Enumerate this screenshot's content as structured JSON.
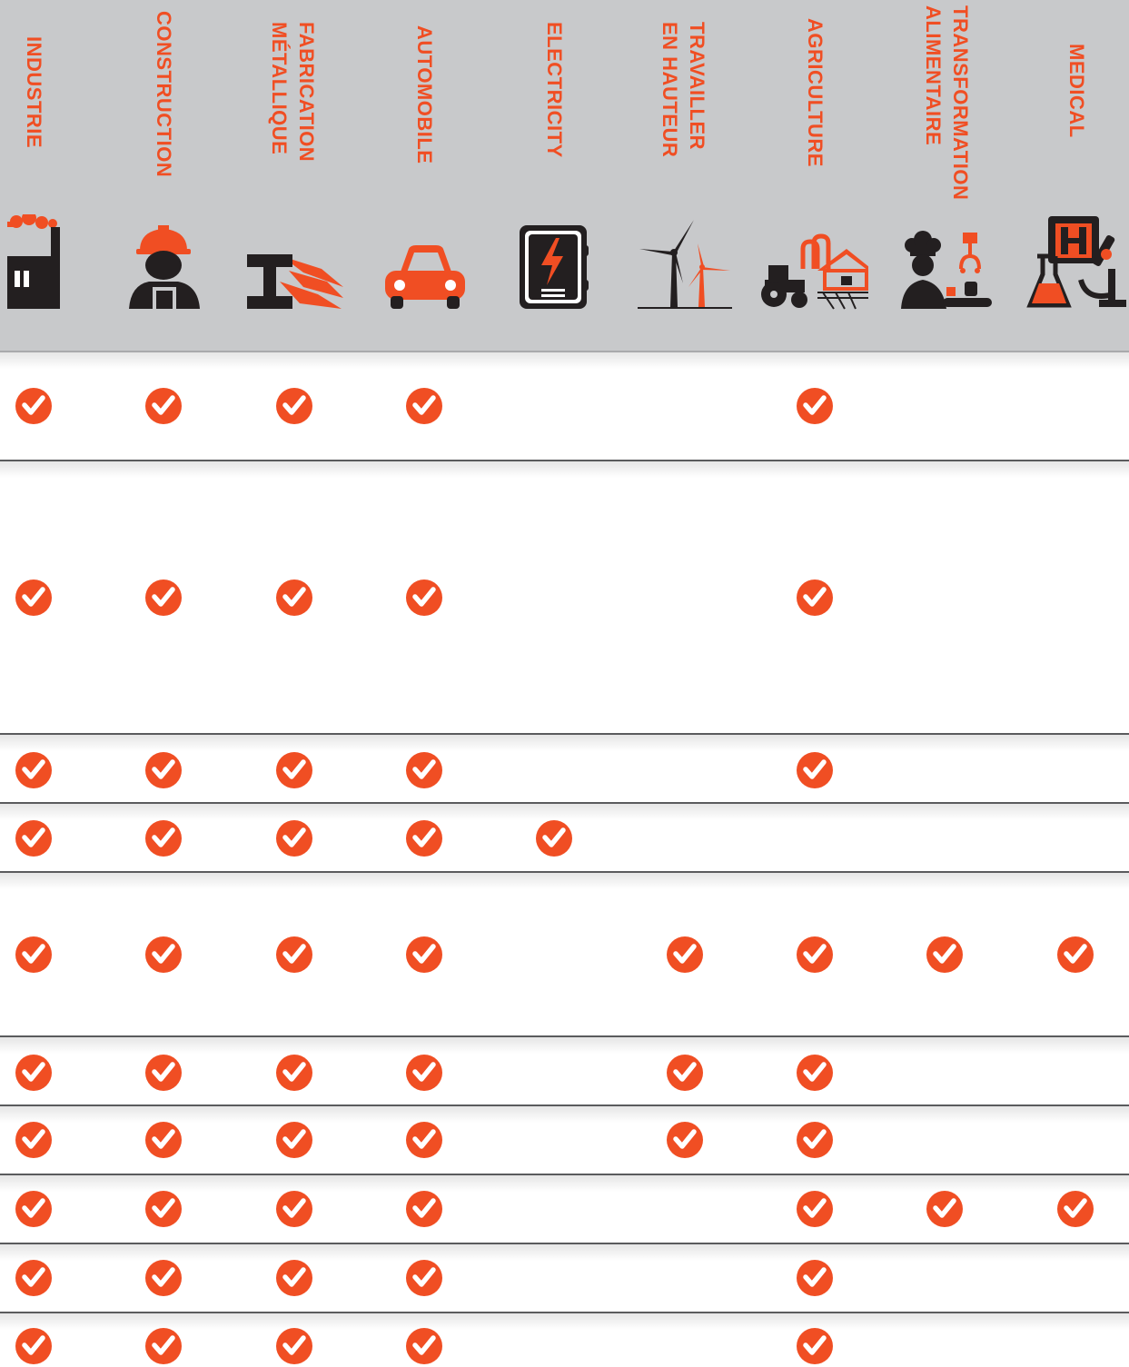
{
  "colors": {
    "accent": "#f04e23",
    "dark": "#231f20",
    "header_bg": "#c8c9cb"
  },
  "columns": [
    {
      "label": "INDUSTRIE",
      "icon": "factory-icon"
    },
    {
      "label": "CONSTRUCTION",
      "icon": "construction-worker-icon"
    },
    {
      "label": "FABRICATION\nMÉTALLIQUE",
      "icon": "steel-beam-icon"
    },
    {
      "label": "AUTOMOBILE",
      "icon": "car-icon"
    },
    {
      "label": "ELECTRICITY",
      "icon": "electrical-panel-icon"
    },
    {
      "label": "TRAVAILLER\nEN HAUTEUR",
      "icon": "wind-turbine-icon"
    },
    {
      "label": "AGRICULTURE",
      "icon": "farm-tractor-icon"
    },
    {
      "label": "TRANSFORMATION\nALIMENTAIRE",
      "icon": "chef-food-processing-icon"
    },
    {
      "label": "MEDICAL",
      "icon": "medical-lab-icon"
    }
  ],
  "rows": [
    [
      true,
      true,
      true,
      true,
      false,
      false,
      true,
      false,
      false
    ],
    [
      true,
      true,
      true,
      true,
      false,
      false,
      true,
      false,
      false
    ],
    [
      true,
      true,
      true,
      true,
      false,
      false,
      true,
      false,
      false
    ],
    [
      true,
      true,
      true,
      true,
      true,
      false,
      false,
      false,
      false
    ],
    [
      true,
      true,
      true,
      true,
      false,
      true,
      true,
      true,
      true
    ],
    [
      true,
      true,
      true,
      true,
      false,
      true,
      true,
      false,
      false
    ],
    [
      true,
      true,
      true,
      true,
      false,
      true,
      true,
      false,
      false
    ],
    [
      true,
      true,
      true,
      true,
      false,
      false,
      true,
      true,
      true
    ],
    [
      true,
      true,
      true,
      true,
      false,
      false,
      true,
      false,
      false
    ],
    [
      true,
      true,
      true,
      true,
      false,
      false,
      true,
      false,
      false
    ]
  ]
}
